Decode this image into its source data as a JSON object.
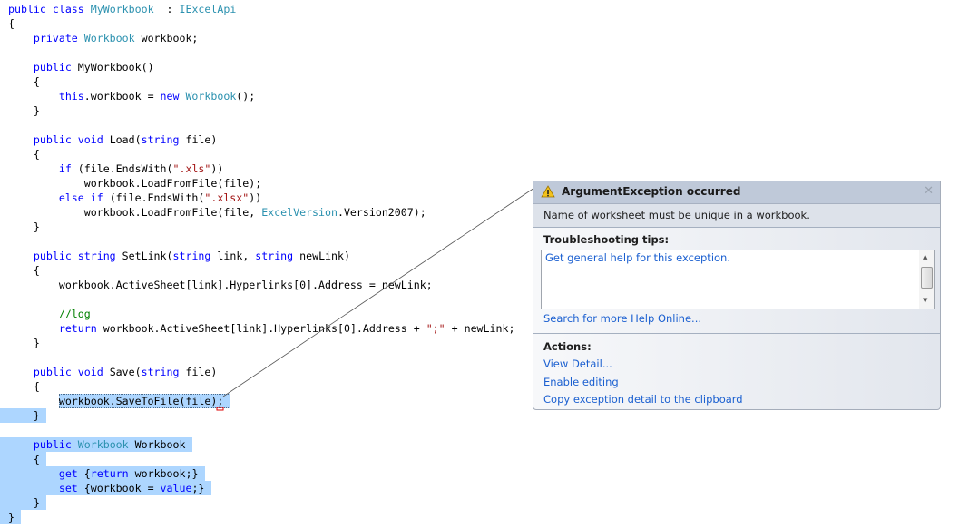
{
  "editor": {
    "lines": [
      [
        [
          "kw",
          "public class "
        ],
        [
          "ty",
          "MyWorkbook"
        ],
        [
          "",
          "  : "
        ],
        [
          "ty",
          "IExcelApi"
        ]
      ],
      [
        [
          "",
          "{"
        ]
      ],
      [
        [
          "",
          "    "
        ],
        [
          "kw",
          "private "
        ],
        [
          "ty",
          "Workbook"
        ],
        [
          "",
          " workbook;"
        ]
      ],
      [],
      [
        [
          "",
          "    "
        ],
        [
          "kw",
          "public "
        ],
        [
          "",
          "MyWorkbook()"
        ]
      ],
      [
        [
          "",
          "    {"
        ]
      ],
      [
        [
          "",
          "        "
        ],
        [
          "kw",
          "this"
        ],
        [
          "",
          ".workbook = "
        ],
        [
          "kw",
          "new "
        ],
        [
          "ty",
          "Workbook"
        ],
        [
          "",
          "();"
        ]
      ],
      [
        [
          "",
          "    }"
        ]
      ],
      [],
      [
        [
          "",
          "    "
        ],
        [
          "kw",
          "public void "
        ],
        [
          "",
          "Load("
        ],
        [
          "kw",
          "string "
        ],
        [
          "",
          "file)"
        ]
      ],
      [
        [
          "",
          "    {"
        ]
      ],
      [
        [
          "",
          "        "
        ],
        [
          "kw",
          "if "
        ],
        [
          "",
          "(file.EndsWith("
        ],
        [
          "st",
          "\".xls\""
        ],
        [
          "",
          "))"
        ]
      ],
      [
        [
          "",
          "            workbook.LoadFromFile(file);"
        ]
      ],
      [
        [
          "",
          "        "
        ],
        [
          "kw",
          "else if "
        ],
        [
          "",
          "(file.EndsWith("
        ],
        [
          "st",
          "\".xlsx\""
        ],
        [
          "",
          "))"
        ]
      ],
      [
        [
          "",
          "            workbook.LoadFromFile(file, "
        ],
        [
          "ty",
          "ExcelVersion"
        ],
        [
          "",
          ".Version2007);"
        ]
      ],
      [
        [
          "",
          "    }"
        ]
      ],
      [],
      [
        [
          "",
          "    "
        ],
        [
          "kw",
          "public string "
        ],
        [
          "",
          "SetLink("
        ],
        [
          "kw",
          "string "
        ],
        [
          "",
          "link, "
        ],
        [
          "kw",
          "string "
        ],
        [
          "",
          "newLink)"
        ]
      ],
      [
        [
          "",
          "    {"
        ]
      ],
      [
        [
          "",
          "        workbook.ActiveSheet[link].Hyperlinks[0].Address = newLink;"
        ]
      ],
      [],
      [
        [
          "",
          "        "
        ],
        [
          "cm",
          "//log"
        ]
      ],
      [
        [
          "",
          "        "
        ],
        [
          "kw",
          "return "
        ],
        [
          "",
          "workbook.ActiveSheet[link].Hyperlinks[0].Address + "
        ],
        [
          "st",
          "\";\""
        ],
        [
          "",
          " + newLink;"
        ]
      ],
      [
        [
          "",
          "    }"
        ]
      ],
      [],
      [
        [
          "",
          "    "
        ],
        [
          "kw",
          "public void "
        ],
        [
          "",
          "Save("
        ],
        [
          "kw",
          "string "
        ],
        [
          "",
          "file)"
        ]
      ],
      [
        [
          "",
          "    {"
        ]
      ],
      [
        [
          "",
          "        workbook.SaveToFile(file);"
        ]
      ],
      [
        [
          "",
          "    }"
        ]
      ],
      [],
      [
        [
          "",
          "    "
        ],
        [
          "kw",
          "public "
        ],
        [
          "ty",
          "Workbook"
        ],
        [
          "",
          " Workbook"
        ]
      ],
      [
        [
          "",
          "    {"
        ]
      ],
      [
        [
          "",
          "        "
        ],
        [
          "kw",
          "get "
        ],
        [
          "",
          "{"
        ],
        [
          "kw",
          "return "
        ],
        [
          "",
          "workbook;}"
        ]
      ],
      [
        [
          "",
          "        "
        ],
        [
          "kw",
          "set "
        ],
        [
          "",
          "{workbook = "
        ],
        [
          "kw",
          "value"
        ],
        [
          "",
          ";}"
        ]
      ],
      [
        [
          "",
          "    }"
        ]
      ],
      [
        [
          "",
          "}"
        ]
      ]
    ],
    "colors": {
      "keyword": "#0000ff",
      "type": "#2b91af",
      "string": "#a31515",
      "comment": "#008000",
      "selection": "#add6ff"
    }
  },
  "exception": {
    "icon": "warning-icon",
    "title": "ArgumentException occurred",
    "close_icon": "close-icon",
    "message": "Name of worksheet must be unique in a workbook.",
    "tips_heading": "Troubleshooting tips:",
    "tips": [
      "Get general help for this exception."
    ],
    "search_link": "Search for more Help Online...",
    "actions_heading": "Actions:",
    "actions": [
      "View Detail...",
      "Enable editing",
      "Copy exception detail to the clipboard"
    ]
  }
}
